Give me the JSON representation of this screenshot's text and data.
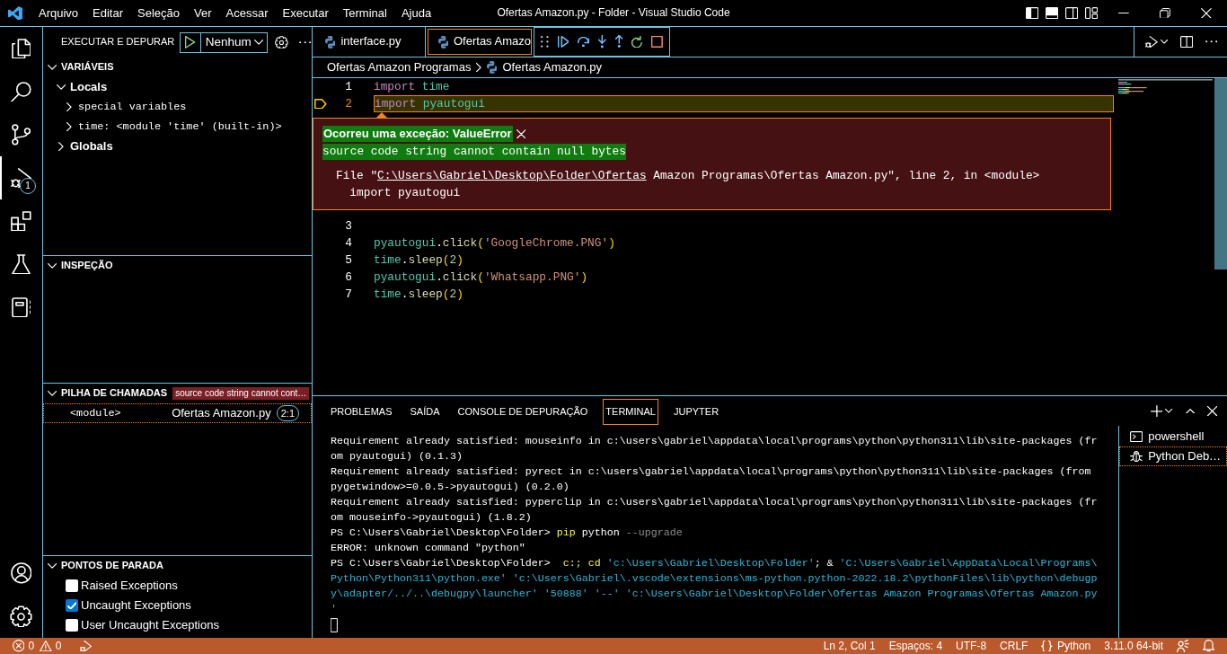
{
  "window": {
    "title": "Ofertas Amazon.py - Folder - Visual Studio Code"
  },
  "menu": [
    "Arquivo",
    "Editar",
    "Seleção",
    "Ver",
    "Acessar",
    "Executar",
    "Terminal",
    "Ajuda"
  ],
  "activity_bar": {
    "items": [
      {
        "selected": false
      },
      {
        "selected": false
      },
      {
        "selected": false
      },
      {
        "selected": true,
        "badge": "1"
      },
      {
        "selected": false
      },
      {
        "selected": false
      },
      {
        "selected": false
      }
    ]
  },
  "sidebar": {
    "title": "EXECUTAR E DEPURAR",
    "launch_config": "Nenhum",
    "sections": [
      {
        "kind": "variables",
        "title": "VARIÁVEIS",
        "expanded": true,
        "tree": [
          {
            "label": "Locals",
            "expanded": true,
            "children": [
              {
                "label": "special variables",
                "expanded": false
              },
              {
                "label": "time: <module 'time' (built-in)>",
                "expanded": false
              }
            ]
          },
          {
            "label": "Globals",
            "expanded": false
          }
        ]
      },
      {
        "kind": "watch",
        "title": "INSPEÇÃO",
        "expanded": true
      },
      {
        "kind": "call_stack",
        "title": "PILHA DE CHAMADAS",
        "expanded": true,
        "badge": "source code string cannot cont…",
        "frames": [
          {
            "name": "<module>",
            "file": "Ofertas Amazon.py",
            "position": "2:1",
            "selected": true
          }
        ]
      },
      {
        "kind": "breakpoints",
        "title": "PONTOS DE PARADA",
        "expanded": true,
        "items": [
          {
            "label": "Raised Exceptions",
            "checked": false
          },
          {
            "label": "Uncaught Exceptions",
            "checked": true
          },
          {
            "label": "User Uncaught Exceptions",
            "checked": false
          }
        ]
      }
    ]
  },
  "editor": {
    "tabs": [
      {
        "label": "interface.py",
        "selected": false
      },
      {
        "label": "Ofertas Amazo",
        "selected": true
      }
    ],
    "breadcrumbs": [
      {
        "label": "Ofertas Amazon Programas",
        "kind": "folder"
      },
      {
        "label": "Ofertas Amazon.py",
        "kind": "file"
      }
    ],
    "lines": [
      {
        "number": "1",
        "current": false,
        "tokens": [
          {
            "text": "import ",
            "kind": "keyword"
          },
          {
            "text": "time",
            "kind": "module"
          }
        ]
      },
      {
        "number": "2",
        "current": true,
        "tokens": [
          {
            "text": "import ",
            "kind": "keyword"
          },
          {
            "text": "pyautogui",
            "kind": "module"
          }
        ],
        "exception": {
          "title": "Ocorreu uma exceção: ValueError",
          "message": "source code string cannot contain null bytes",
          "trace": [
            {
              "kind": "location",
              "parts": [
                {
                  "text": "File \"",
                  "kind": "plain"
                },
                {
                  "text": "C:\\Users\\Gabriel\\Desktop\\Folder\\Ofertas",
                  "kind": "link"
                },
                {
                  "text": " Amazon Programas\\Ofertas Amazon.py\", line 2, in <module>",
                  "kind": "plain"
                }
              ]
            },
            {
              "kind": "source",
              "parts": [
                {
                  "text": "import pyautogui",
                  "kind": "plain"
                }
              ]
            }
          ]
        }
      },
      {
        "number": "3",
        "current": false
      },
      {
        "number": "4",
        "current": false,
        "tokens": [
          {
            "text": "pyautogui",
            "kind": "module"
          },
          {
            "text": ".",
            "kind": "plain"
          },
          {
            "text": "click",
            "kind": "function"
          },
          {
            "text": "(",
            "kind": "bracket"
          },
          {
            "text": "'GoogleChrome.PNG'",
            "kind": "string"
          },
          {
            "text": ")",
            "kind": "bracket"
          }
        ]
      },
      {
        "number": "5",
        "current": false,
        "tokens": [
          {
            "text": "time",
            "kind": "module"
          },
          {
            "text": ".",
            "kind": "plain"
          },
          {
            "text": "sleep",
            "kind": "function"
          },
          {
            "text": "(",
            "kind": "bracket"
          },
          {
            "text": "2",
            "kind": "number"
          },
          {
            "text": ")",
            "kind": "bracket"
          }
        ]
      },
      {
        "number": "6",
        "current": false,
        "tokens": [
          {
            "text": "pyautogui",
            "kind": "module"
          },
          {
            "text": ".",
            "kind": "plain"
          },
          {
            "text": "click",
            "kind": "function"
          },
          {
            "text": "(",
            "kind": "bracket"
          },
          {
            "text": "'Whatsapp.PNG'",
            "kind": "string"
          },
          {
            "text": ")",
            "kind": "bracket"
          }
        ]
      },
      {
        "number": "7",
        "current": false,
        "tokens": [
          {
            "text": "time",
            "kind": "module"
          },
          {
            "text": ".",
            "kind": "plain"
          },
          {
            "text": "sleep",
            "kind": "function"
          },
          {
            "text": "(",
            "kind": "bracket"
          },
          {
            "text": "2",
            "kind": "number"
          },
          {
            "text": ")",
            "kind": "bracket"
          }
        ]
      }
    ]
  },
  "panel": {
    "tabs": [
      {
        "label": "PROBLEMAS",
        "selected": false
      },
      {
        "label": "SAÍDA",
        "selected": false
      },
      {
        "label": "CONSOLE DE DEPURAÇÃO",
        "selected": false
      },
      {
        "label": "TERMINAL",
        "selected": true
      },
      {
        "label": "JUPYTER",
        "selected": false
      }
    ],
    "terminal": {
      "rows": [
        {
          "segments": [
            {
              "text": "Requirement already satisfied: mouseinfo in c:\\users\\gabriel\\appdata\\local\\programs\\python\\python311\\lib\\site-packages (fr",
              "kind": "plain"
            }
          ]
        },
        {
          "segments": [
            {
              "text": "om pyautogui) (0.1.3)",
              "kind": "plain"
            }
          ]
        },
        {
          "segments": [
            {
              "text": "Requirement already satisfied: pyrect in c:\\users\\gabriel\\appdata\\local\\programs\\python\\python311\\lib\\site-packages (from",
              "kind": "plain"
            }
          ]
        },
        {
          "segments": [
            {
              "text": "pygetwindow>=0.0.5->pyautogui) (0.2.0)",
              "kind": "plain"
            }
          ]
        },
        {
          "segments": [
            {
              "text": "Requirement already satisfied: pyperclip in c:\\users\\gabriel\\appdata\\local\\programs\\python\\python311\\lib\\site-packages (fr",
              "kind": "plain"
            }
          ]
        },
        {
          "segments": [
            {
              "text": "om mouseinfo->pyautogui) (1.8.2)",
              "kind": "plain"
            }
          ]
        },
        {
          "segments": [
            {
              "text": "PS C:\\Users\\Gabriel\\Desktop\\Folder> ",
              "kind": "plain"
            },
            {
              "text": "pip",
              "kind": "command"
            },
            {
              "text": " python ",
              "kind": "plain"
            },
            {
              "text": "--upgrade",
              "kind": "parameter"
            }
          ]
        },
        {
          "segments": [
            {
              "text": "ERROR: unknown command \"python\"",
              "kind": "plain"
            }
          ]
        },
        {
          "segments": [
            {
              "text": "PS C:\\Users\\Gabriel\\Desktop\\Folder> ",
              "kind": "plain"
            },
            {
              "text": " c:; cd",
              "kind": "command"
            },
            {
              "text": " 'c:\\Users\\Gabriel\\Desktop\\Folder'",
              "kind": "string"
            },
            {
              "text": "; & ",
              "kind": "plain"
            },
            {
              "text": "'C:\\Users\\Gabriel\\AppData\\Local\\Programs\\",
              "kind": "string"
            }
          ]
        },
        {
          "segments": [
            {
              "text": "Python\\Python311\\python.exe' 'c:\\Users\\Gabriel\\.vscode\\extensions\\ms-python.python-2022.18.2\\pythonFiles\\lib\\python\\debugp",
              "kind": "string"
            }
          ]
        },
        {
          "segments": [
            {
              "text": "y\\adapter/../..\\debugpy\\launcher' '50888' '--' 'c:\\Users\\Gabriel\\Desktop\\Folder\\Ofertas Amazon Programas\\Ofertas Amazon.py",
              "kind": "string"
            }
          ]
        },
        {
          "segments": [
            {
              "text": "'",
              "kind": "string"
            }
          ]
        }
      ]
    },
    "terminals": [
      {
        "label": "powershell",
        "kind": "shell",
        "selected": false
      },
      {
        "label": "Python Deb…",
        "kind": "debug",
        "selected": true
      }
    ]
  },
  "status_bar": {
    "errors": "0",
    "warnings": "0",
    "items": [
      {
        "text": "Ln 2, Col 1",
        "kind": "plain"
      },
      {
        "text": "Espaços: 4",
        "kind": "plain"
      },
      {
        "text": "UTF-8",
        "kind": "plain"
      },
      {
        "text": "CRLF",
        "kind": "plain"
      },
      {
        "text": "Python",
        "kind": "language"
      },
      {
        "text": "3.11.0 64-bit",
        "kind": "plain"
      }
    ]
  }
}
